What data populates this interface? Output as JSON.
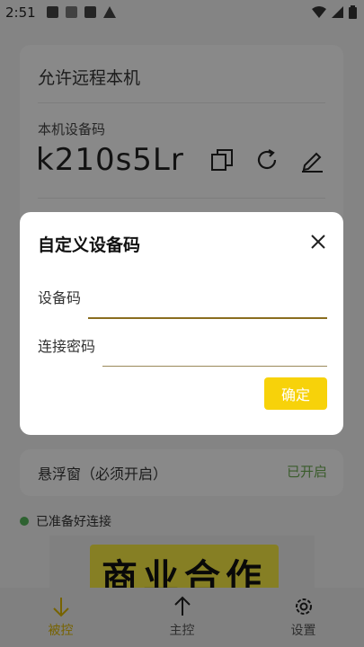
{
  "status_bar": {
    "time": "2:51"
  },
  "main_card": {
    "title": "允许远程本机",
    "code_label": "本机设备码",
    "device_code": "k210s5Lr",
    "actions": [
      "copy-icon",
      "refresh-icon",
      "edit-icon"
    ]
  },
  "float_card": {
    "label": "悬浮窗（必须开启）",
    "status": "已开启"
  },
  "ready_status": "已准备好连接",
  "promo_text": "商业合作",
  "bottom_nav": {
    "items": [
      {
        "label": "被控",
        "icon": "arrow-down-icon",
        "active": true
      },
      {
        "label": "主控",
        "icon": "arrow-up-icon",
        "active": false
      },
      {
        "label": "设置",
        "icon": "gear-icon",
        "active": false
      }
    ]
  },
  "dialog": {
    "title": "自定义设备码",
    "device_code_label": "设备码",
    "device_code_value": "",
    "password_label": "连接密码",
    "password_value": "",
    "confirm_label": "确定"
  },
  "colors": {
    "accent": "#f7d20a",
    "active_nav": "#d9b400",
    "status_green": "#6aa84f"
  }
}
